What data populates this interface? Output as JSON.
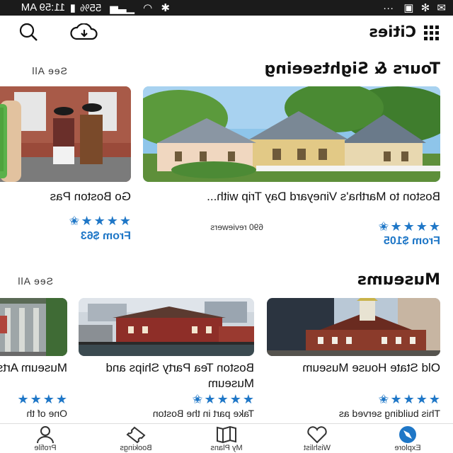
{
  "status_bar": {
    "time": "11:59 AM",
    "battery": "55%",
    "more": "···"
  },
  "app": {
    "title": "Cities"
  },
  "tours": {
    "heading": "Tours & Sightseeing",
    "see_all": "See All",
    "cards": [
      {
        "title": "Boston to Martha's Vineyard Day Trip with...",
        "reviews": "690 reviewers",
        "price": "From $105",
        "rating": 4.5
      },
      {
        "title": "Go Boston Pas",
        "price": "From $63",
        "rating": 4.5
      }
    ]
  },
  "museums": {
    "heading": "Museums",
    "see_all": "See All",
    "cards": [
      {
        "title": "Old State House Museum",
        "desc": "This building served as",
        "rating": 4.5
      },
      {
        "title": "Boston Tea Party Ships and Museum",
        "desc": "Take part in the Boston",
        "rating": 4.5
      },
      {
        "title": "Museum Arts",
        "desc": "One of th",
        "rating": 4.5
      }
    ]
  },
  "bottom_nav": [
    {
      "label": "Explore",
      "icon": "compass-icon",
      "active": true
    },
    {
      "label": "Wishlist",
      "icon": "heart-icon"
    },
    {
      "label": "My Plans",
      "icon": "map-icon"
    },
    {
      "label": "Bookings",
      "icon": "ticket-icon"
    },
    {
      "label": "Profile",
      "icon": "person-icon"
    }
  ],
  "colors": {
    "accent": "#1f77c7",
    "statusbar": "#1b1b1b"
  }
}
